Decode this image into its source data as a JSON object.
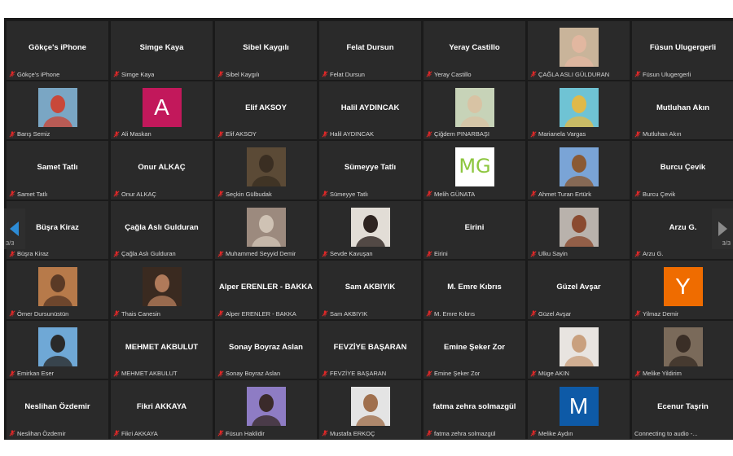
{
  "pagination": {
    "indicator": "3/3"
  },
  "colors": {
    "stage": "#1a1a1a",
    "tile": "#2a2a2a",
    "muted_mic": "#e02828",
    "arrow_left": "#2d8cd6",
    "arrow_right": "#8a8a8a"
  },
  "tiles": [
    {
      "name": "Gökçe's iPhone",
      "label": "Gökçe's iPhone"
    },
    {
      "name": "Simge Kaya",
      "label": "Simge Kaya"
    },
    {
      "name": "Sibel Kaygılı",
      "label": "Sibel Kaygılı"
    },
    {
      "name": "Felat Dursun",
      "label": "Felat Dursun"
    },
    {
      "name": "Yeray Castillo",
      "label": "Yeray Castillo"
    },
    {
      "name": "",
      "label": "ÇAĞLA ASLI GÜLDURAN",
      "avatar": "photo",
      "photo_colors": [
        "#c9b49a",
        "#e2b7a0"
      ]
    },
    {
      "name": "Füsun Ulugergerli",
      "label": "Füsun Ulugergerli"
    },
    {
      "name": "",
      "label": "Barış Semiz",
      "avatar": "photo",
      "photo_colors": [
        "#7aa6c4",
        "#c8483a"
      ]
    },
    {
      "name": "",
      "label": "Ali Maskan",
      "avatar": "letter",
      "letter": "A",
      "avatar_color": "#c2185b"
    },
    {
      "name": "Elif AKSOY",
      "label": "Elif AKSOY"
    },
    {
      "name": "Halil AYDINCAK",
      "label": "Halil AYDINCAK"
    },
    {
      "name": "",
      "label": "Çiğdem PINARBAŞI",
      "avatar": "photo",
      "photo_colors": [
        "#c7d3b8",
        "#d8c3a4"
      ]
    },
    {
      "name": "",
      "label": "Marianela Vargas",
      "avatar": "photo",
      "photo_colors": [
        "#6fc3d4",
        "#e0b94a"
      ]
    },
    {
      "name": "Mutluhan Akın",
      "label": "Mutluhan Akın"
    },
    {
      "name": "Samet Tatlı",
      "label": "Samet Tatlı"
    },
    {
      "name": "Onur ALKAÇ",
      "label": "Onur ALKAÇ"
    },
    {
      "name": "",
      "label": "Seçkin Gülbudak",
      "avatar": "photo",
      "photo_colors": [
        "#5b4a36",
        "#3a2e22"
      ]
    },
    {
      "name": "Sümeyye Tatlı",
      "label": "Sümeyye Tatlı"
    },
    {
      "name": "",
      "label": "Melih GÜNATA",
      "avatar": "logo",
      "logo_text": "MG"
    },
    {
      "name": "",
      "label": "Ahmet Turan Ertürk",
      "avatar": "photo",
      "photo_colors": [
        "#7aa4d6",
        "#8a5a34"
      ]
    },
    {
      "name": "Burcu Çevik",
      "label": "Burcu Çevik"
    },
    {
      "name": "Büşra Kiraz",
      "label": "Büşra Kiraz"
    },
    {
      "name": "Çağla Aslı Gulduran",
      "label": "Çağla Aslı Gulduran"
    },
    {
      "name": "",
      "label": "Muhammed Seyyid Demir",
      "avatar": "photo",
      "photo_colors": [
        "#9c8a7e",
        "#cfc2b4"
      ]
    },
    {
      "name": "",
      "label": "Sevde Kavuşan",
      "avatar": "photo",
      "photo_colors": [
        "#e2ddd6",
        "#2e2420"
      ]
    },
    {
      "name": "Eirini",
      "label": "Eirini"
    },
    {
      "name": "",
      "label": "Ulku Sayin",
      "avatar": "photo",
      "photo_colors": [
        "#b9b2ac",
        "#8a4a30"
      ]
    },
    {
      "name": "Arzu G.",
      "label": "Arzu G."
    },
    {
      "name": "",
      "label": "Ömer Dursunüstün",
      "avatar": "photo",
      "photo_colors": [
        "#b77a4a",
        "#5a3a26"
      ]
    },
    {
      "name": "",
      "label": "Thais Canesin",
      "avatar": "photo",
      "photo_colors": [
        "#3a2a20",
        "#b07a5a"
      ]
    },
    {
      "name": "Alper ERENLER - BAKKA",
      "label": "Alper ERENLER - BAKKA"
    },
    {
      "name": "Sam AKBIYIK",
      "label": "Sam AKBIYIK"
    },
    {
      "name": "M. Emre Kıbrıs",
      "label": "M. Emre Kıbrıs"
    },
    {
      "name": "Güzel Avşar",
      "label": "Güzel Avşar"
    },
    {
      "name": "",
      "label": "Yilmaz Demir",
      "avatar": "letter",
      "letter": "Y",
      "avatar_color": "#ef6c00"
    },
    {
      "name": "",
      "label": "Emirkan Eser",
      "avatar": "photo",
      "photo_colors": [
        "#6fa8d6",
        "#2a2a2a"
      ]
    },
    {
      "name": "MEHMET AKBULUT",
      "label": "MEHMET AKBULUT"
    },
    {
      "name": "Sonay Boyraz Aslan",
      "label": "Sonay Boyraz Aslan"
    },
    {
      "name": "FEVZİYE BAŞARAN",
      "label": "FEVZİYE BAŞARAN"
    },
    {
      "name": "Emine Şeker Zor",
      "label": "Emine Şeker Zor"
    },
    {
      "name": "",
      "label": "Müge AKIN",
      "avatar": "photo",
      "photo_colors": [
        "#e8e4e0",
        "#c9a07e"
      ]
    },
    {
      "name": "",
      "label": "Melike Yildirim",
      "avatar": "photo",
      "photo_colors": [
        "#7a6a5a",
        "#3a2e26"
      ]
    },
    {
      "name": "Neslihan Özdemir",
      "label": "Neslihan Özdemir"
    },
    {
      "name": "Fikri AKKAYA",
      "label": "Fikri AKKAYA"
    },
    {
      "name": "",
      "label": "Füsun Haklidir",
      "avatar": "photo",
      "photo_colors": [
        "#8e7cc4",
        "#3a2a2a"
      ]
    },
    {
      "name": "",
      "label": "Mustafa ERKOÇ",
      "avatar": "photo",
      "photo_colors": [
        "#e4e4e4",
        "#a0704e"
      ]
    },
    {
      "name": "fatma zehra solmazgül",
      "label": "fatma zehra solmazgül"
    },
    {
      "name": "",
      "label": "Melike Aydın",
      "avatar": "letter",
      "letter": "M",
      "avatar_color": "#0e5aa7"
    },
    {
      "name": "Ecenur Taşrin",
      "label": "Connecting to audio -...",
      "no_mic": true
    }
  ]
}
